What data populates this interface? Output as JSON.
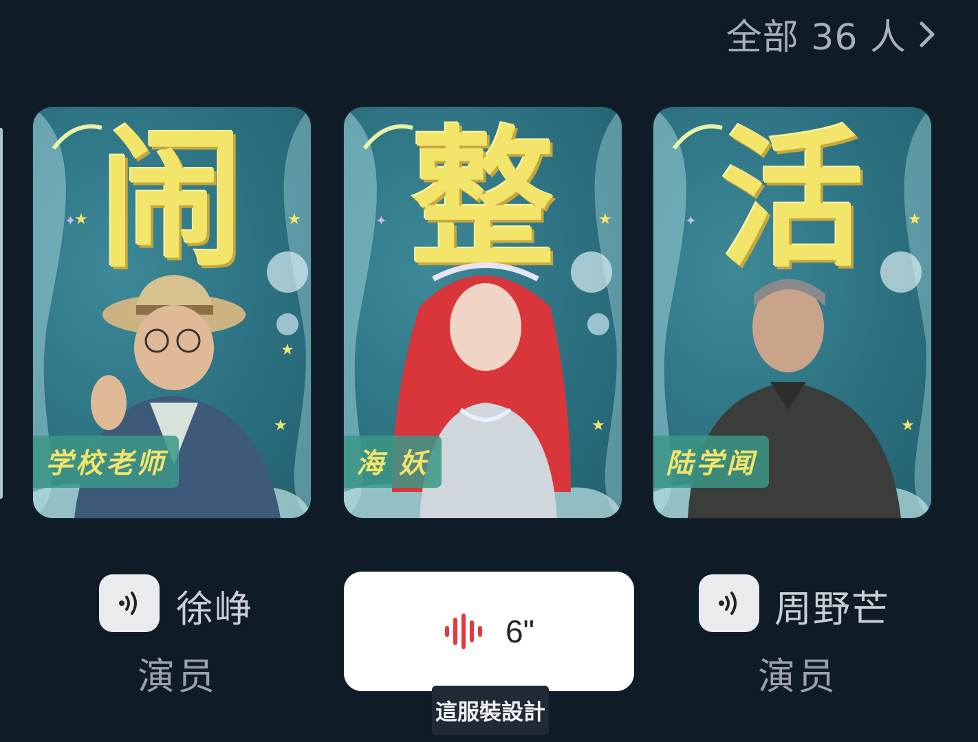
{
  "header": {
    "all_link_label": "全部 36 人"
  },
  "cast": [
    {
      "banner_char": "闹",
      "role_label": "学校老师",
      "actor_name": "徐峥",
      "actor_role": "演员"
    },
    {
      "banner_char": "整",
      "role_label": "海 妖",
      "audio_duration": "6\""
    },
    {
      "banner_char": "活",
      "role_label": "陆学闻",
      "actor_name": "周野芒",
      "actor_role": "演员"
    }
  ],
  "caption": "這服裝設計",
  "colors": {
    "background": "#0f1b27",
    "card_teal": "#2c7181",
    "banner_yellow": "#f3e46a",
    "audio_red": "#e23b3b"
  },
  "icons": [
    "chevron-right-icon",
    "voice-icon",
    "audio-wave-icon"
  ]
}
